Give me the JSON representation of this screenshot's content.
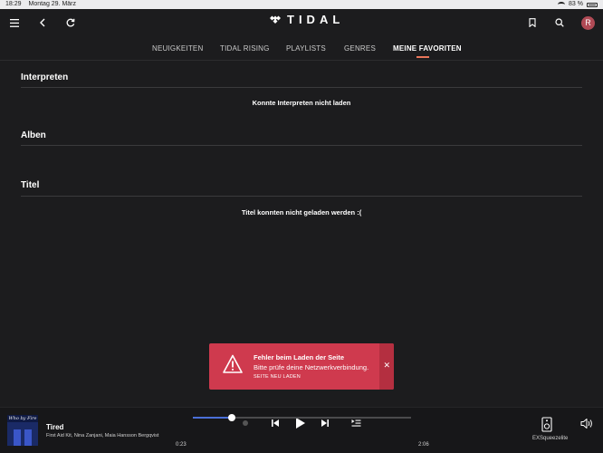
{
  "status_bar": {
    "time": "18:29",
    "date": "Montag 29. März",
    "battery": "83 %"
  },
  "header": {
    "brand": "TIDAL",
    "avatar_initial": "R"
  },
  "tabs": [
    {
      "label": "NEUIGKEITEN",
      "active": false
    },
    {
      "label": "TIDAL RISING",
      "active": false
    },
    {
      "label": "PLAYLISTS",
      "active": false
    },
    {
      "label": "GENRES",
      "active": false
    },
    {
      "label": "MEINE FAVORITEN",
      "active": true
    }
  ],
  "sections": {
    "artists": {
      "title": "Interpreten",
      "message": "Konnte Interpreten nicht laden"
    },
    "albums": {
      "title": "Alben"
    },
    "tracks": {
      "title": "Titel",
      "message": "Titel konnten nicht geladen werden :("
    }
  },
  "toast": {
    "title": "Fehler beim Laden der Seite",
    "message": "Bitte prüfe deine Netzwerkverbindung.",
    "action": "SEITE NEU LADEN"
  },
  "player": {
    "cover_text": "Who by Fire",
    "title": "Tired",
    "artists": "First Aid Kit, Nina Zanjani, Maia Hansson Bergqvist",
    "elapsed": "0:23",
    "duration": "2:06",
    "progress_fraction": 0.18,
    "device": "EXSqueezelite"
  },
  "colors": {
    "accent_tab": "#e9755b",
    "toast": "#cf3a4e",
    "progress": "#4a6fd8"
  }
}
